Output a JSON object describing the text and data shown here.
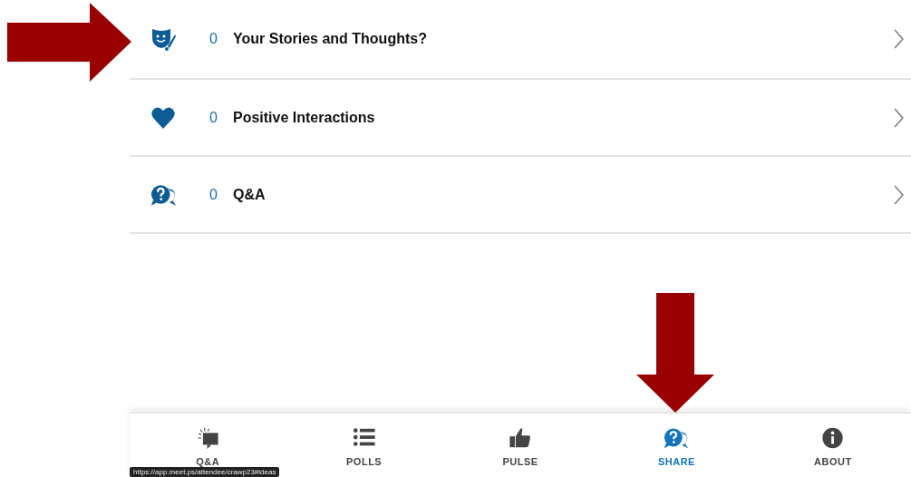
{
  "categories": [
    {
      "kind": "mask",
      "count": "0",
      "label": "Your Stories and Thoughts?"
    },
    {
      "kind": "heart",
      "count": "0",
      "label": "Positive Interactions"
    },
    {
      "kind": "qa",
      "count": "0",
      "label": "Q&A"
    }
  ],
  "tabs": [
    {
      "kind": "chat",
      "label": "Q&A",
      "selected": false
    },
    {
      "kind": "list",
      "label": "POLLS",
      "selected": false
    },
    {
      "kind": "thumb",
      "label": "PULSE",
      "selected": false
    },
    {
      "kind": "qa",
      "label": "SHARE",
      "selected": true
    },
    {
      "kind": "info",
      "label": "ABOUT",
      "selected": false
    }
  ],
  "status_url": "https://app.meet.ps/attendee/crawp23#ideas"
}
